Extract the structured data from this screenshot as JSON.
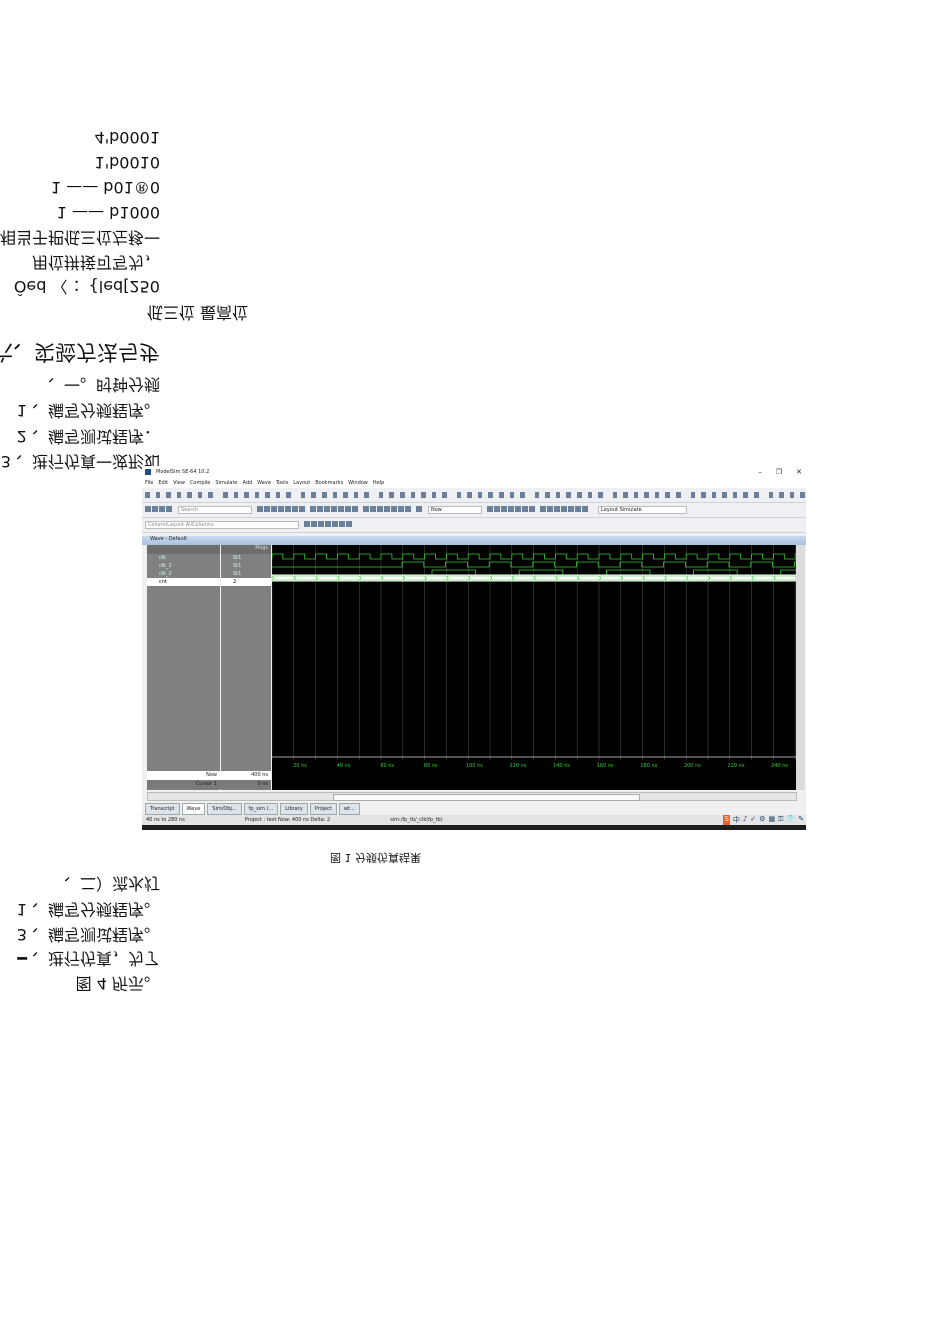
{
  "doc": {
    "lines_top": [
      "4'b0001",
      "1'b0010",
      "1 —— b01®0",
      "1 —— b1000",
      "相当于把低三位左移一",
      "用位拼接可写为，",
      "Ôed 〈 ：{led[250",
      "低三位 最高位",
      "六、实验方法与步",
      "、一。时钟分频",
      "1 、编写分频程序。",
      "2 、编写测试程序．",
      "3 、进行仿真一波形如"
    ],
    "caption": "图 1 分频仿真结果",
    "lines_bottom": [
      "、二）流水灯",
      "1 、编写分频程序。",
      "3 、编写测试程序。",
      "━ 、进行仿真，为了",
      "图 4 所示。"
    ]
  },
  "app": {
    "title": "ModelSim SE-64 10.2",
    "window_controls": [
      "–",
      "❐",
      "✕"
    ],
    "menu": [
      "File",
      "Edit",
      "View",
      "Compile",
      "Simulate",
      "Add",
      "Wave",
      "Tools",
      "Layout",
      "Bookmarks",
      "Window",
      "Help"
    ],
    "search_placeholder": "Search",
    "now_field": "Now",
    "layout_label": "Layout Simulate",
    "column_layout": "ColumnLayout AllColumns",
    "wave_title": "Wave - Default",
    "msgs_header": "Msgs",
    "signals": [
      {
        "name": "clk",
        "value": "St1"
      },
      {
        "name": "clk_1",
        "value": "St1"
      },
      {
        "name": "clk_2",
        "value": "St1"
      },
      {
        "name": "cnt",
        "value": "2"
      }
    ],
    "cursor_rows": [
      {
        "name": "Now",
        "value": "400 ns"
      },
      {
        "name": "Cursor 1",
        "value": "0 ns"
      }
    ],
    "time_labels": [
      "20 ns",
      "40 ns",
      "60 ns",
      "80 ns",
      "100 ns",
      "120 ns",
      "140 ns",
      "160 ns",
      "180 ns",
      "200 ns",
      "220 ns",
      "240 ns"
    ],
    "tabs": [
      "Transcript",
      "Wave",
      "Sim/Obj...",
      "fp_sim (...",
      "Library",
      "Project",
      "wt..."
    ],
    "status": [
      "40 ns to 280 ns",
      "Project : test  Now: 400 ns  Delta: 2",
      "sim:/fp_tb/_clk(fp_tb)"
    ],
    "tray_icons": [
      "S",
      "中",
      "♪",
      "✓",
      "⚙",
      "▦",
      "⚿",
      "👕",
      "✎"
    ],
    "colors": {
      "wave_green": "#2fd12f",
      "wave_bg": "#000000",
      "panel_gray": "#808080"
    }
  }
}
